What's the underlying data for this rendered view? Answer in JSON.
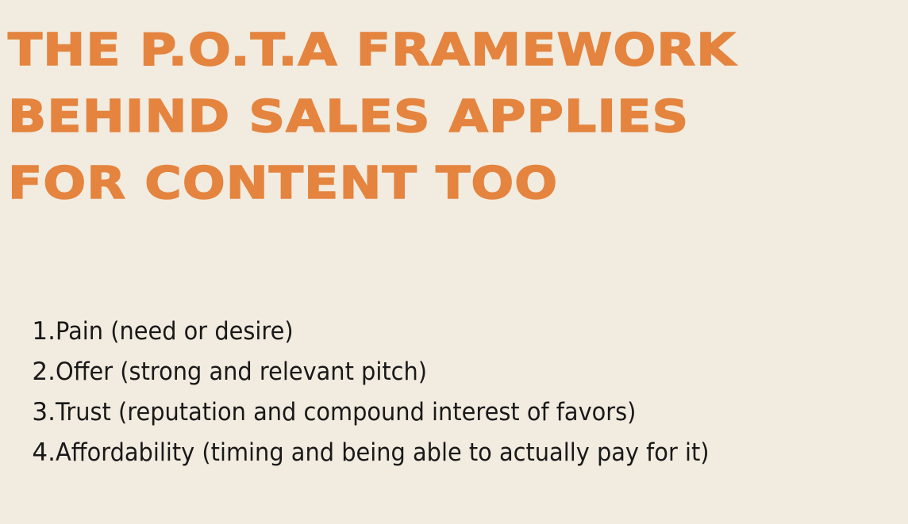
{
  "title_lines": [
    "THE P.O.T.A FRAMEWORK",
    "BEHIND SALES APPLIES",
    "FOR CONTENT TOO"
  ],
  "points": [
    {
      "number": "1.",
      "text": "Pain (need or desire)"
    },
    {
      "number": "2.",
      "text": "Offer (strong and relevant pitch)"
    },
    {
      "number": "3.",
      "text": "Trust (reputation and compound interest of favors)"
    },
    {
      "number": "4.",
      "text": "Affordability (timing and being able to actually pay for it)"
    }
  ],
  "colors": {
    "background": "#f2ebdf",
    "title": "#e4843f",
    "body_text": "#191919"
  }
}
